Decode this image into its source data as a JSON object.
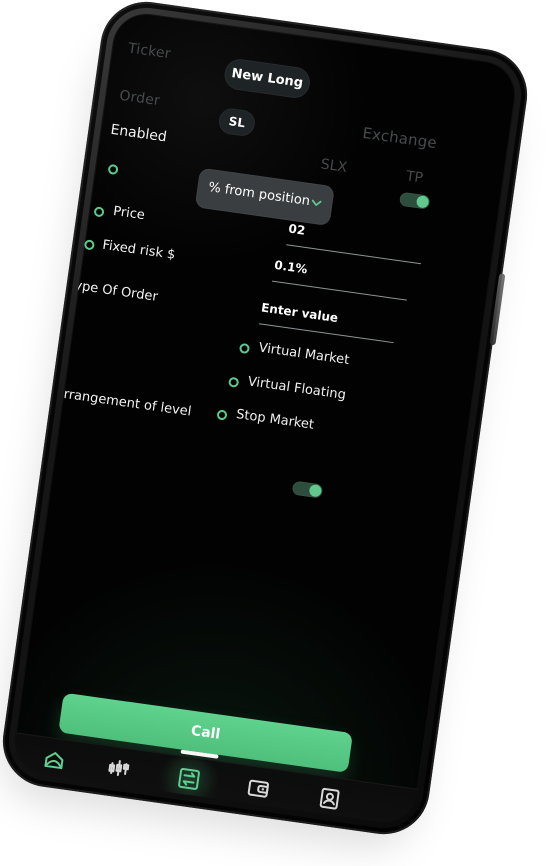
{
  "header": {
    "tabs": {
      "ticker": "Ticker",
      "new_long": "New Long",
      "order": "Order",
      "exchange": "Exchange"
    },
    "mode_tabs": {
      "sl": "SL",
      "slx": "SLX",
      "tp": "TP"
    }
  },
  "settings": {
    "enabled_label": "Enabled",
    "dropdown_value": "% from position",
    "options": {
      "price": "Price",
      "fixed_risk": "Fixed risk $"
    },
    "fields": {
      "first_value": "02",
      "second_value": "0.1%",
      "third_placeholder": "Enter value"
    },
    "type_of_order_label": "Type Of Order",
    "order_types": [
      "Virtual Market",
      "Virtual Floating",
      "Stop Market"
    ],
    "rearrangement_label": "Rearrangement of level"
  },
  "cta": {
    "call_label": "Call"
  },
  "bottom_nav": {
    "items": [
      {
        "label": "Home",
        "icon": "home-icon"
      },
      {
        "label": "Market",
        "icon": "market-icon"
      },
      {
        "label": "ExChange",
        "icon": "exchange-icon"
      },
      {
        "label": "Wallet",
        "icon": "wallet-icon"
      },
      {
        "label": "Account",
        "icon": "account-icon"
      }
    ]
  },
  "colors": {
    "accent": "#5ec98d",
    "screen_bg": "#020202",
    "panel": "#3b3e40"
  }
}
